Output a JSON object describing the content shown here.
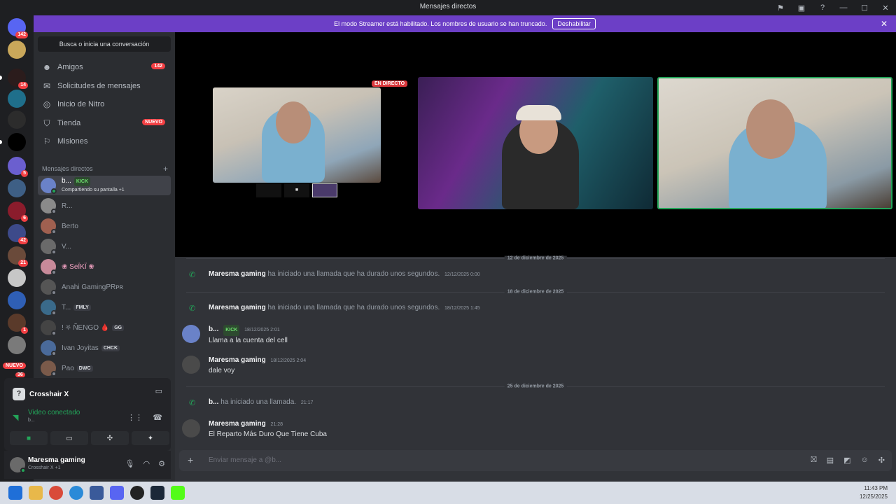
{
  "window": {
    "title": "Mensajes directos"
  },
  "banner": {
    "text": "El modo Streamer está habilitado. Los nombres de usuario se han truncado.",
    "button": "Deshabilitar"
  },
  "servers": {
    "badges": [
      "142",
      "14",
      "5",
      "6",
      "42",
      "21",
      "1",
      "36"
    ],
    "new_label": "NUEVO"
  },
  "sidebar": {
    "search": "Busca o inicia una conversación",
    "nav": [
      {
        "label": "Amigos",
        "badge": "142"
      },
      {
        "label": "Solicitudes de mensajes",
        "badge": ""
      },
      {
        "label": "Inicio de Nitro",
        "badge": ""
      },
      {
        "label": "Tienda",
        "badge": "NUEVO"
      },
      {
        "label": "Misiones",
        "badge": ""
      }
    ],
    "dm_header": "Mensajes directos",
    "dms": [
      {
        "name": "b...",
        "tag": "KICK",
        "sub": "Compartiendo su pantalla +1"
      },
      {
        "name": "R...",
        "tag": ""
      },
      {
        "name": "Berto",
        "tag": ""
      },
      {
        "name": "V...",
        "tag": ""
      },
      {
        "name": "❀ SeÏKÏ ❀",
        "tag": ""
      },
      {
        "name": "Anahi GamingPRᴘʀ",
        "tag": ""
      },
      {
        "name": "T...",
        "tag": "FMLY"
      },
      {
        "name": "! ⛧ ÑENGO 🩸",
        "tag": "GG"
      },
      {
        "name": "Ivan Joyitas",
        "tag": "CHCK"
      },
      {
        "name": "Pao",
        "tag": "DWC"
      }
    ]
  },
  "voice": {
    "channel": "Crosshair X",
    "status": "Video conectado",
    "sub": "b..."
  },
  "user": {
    "name": "Maresma gaming",
    "status": "Crosshair X +1"
  },
  "stage": {
    "live_badge": "EN DIRECTO"
  },
  "chat": {
    "dividers": [
      "12 de diciembre de 2025",
      "18 de diciembre de 2025",
      "25 de diciembre de 2025"
    ],
    "messages": [
      {
        "author": "Maresma gaming",
        "text": "ha iniciado una llamada que ha durado unos segundos.",
        "ts": "12/12/2025 0:00"
      },
      {
        "author": "Maresma gaming",
        "text": "ha iniciado una llamada que ha durado unos segundos.",
        "ts": "18/12/2025 1:45"
      },
      {
        "author": "b...",
        "tag": "KICK",
        "ts": "18/12/2025 2:01",
        "text": "Llama a la cuenta del cell"
      },
      {
        "author": "Maresma gaming",
        "ts": "18/12/2025 2:04",
        "text": "dale voy"
      },
      {
        "author": "b...",
        "text": "ha iniciado una llamada.",
        "ts": "21:17"
      },
      {
        "author": "Maresma gaming",
        "ts": "21:28",
        "text": "El Reparto Más Duro Que Tiene Cuba"
      }
    ],
    "composer_placeholder": "Enviar mensaje a @b..."
  },
  "taskbar": {
    "time": "11:43 PM",
    "date": "12/25/2025"
  },
  "colors": {
    "accent": "#5865f2",
    "banner": "#6c3fc6",
    "green": "#23a559",
    "red": "#f23f43"
  }
}
